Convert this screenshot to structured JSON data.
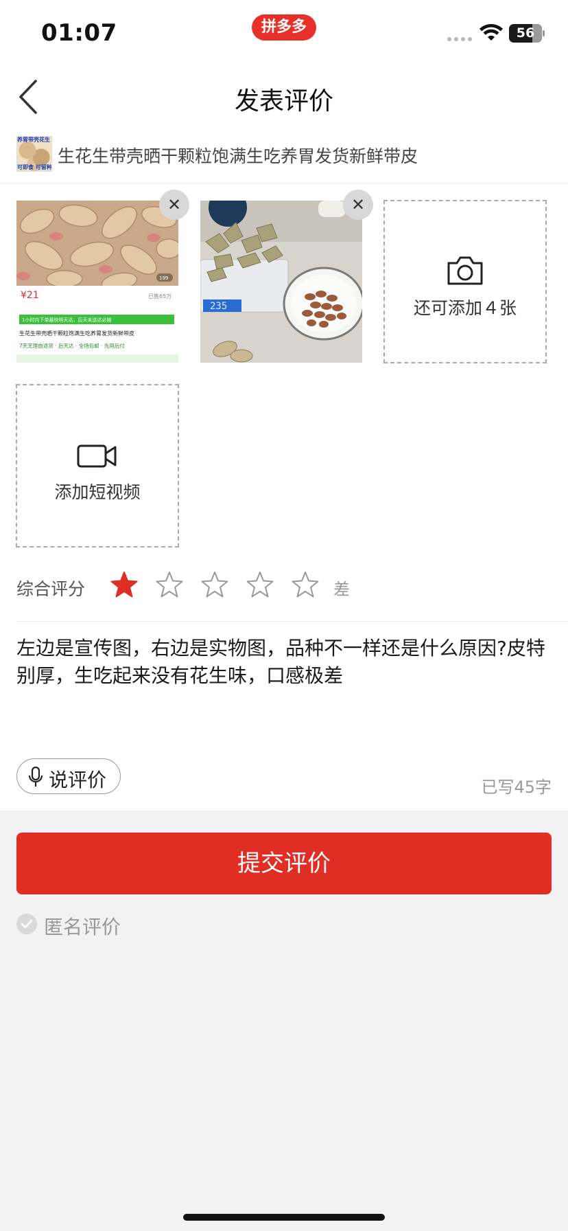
{
  "status_bar": {
    "time": "01:07",
    "app_badge": "拼多多",
    "battery": "56"
  },
  "nav": {
    "title": "发表评价",
    "back_icon": "chevron-left-icon"
  },
  "product": {
    "title": "生花生带壳晒干颗粒饱满生吃养胃发货新鲜带皮",
    "thumb_tag_top": "养胃带壳花生",
    "thumb_tag_bottom": "可即食 可留种"
  },
  "photos": {
    "add_photo_label": "还可添加４张",
    "add_video_label": "添加短视频",
    "remove_icon": "close-icon",
    "photo_1_labels": {
      "price": "¥21",
      "tag": "已售65万",
      "banner": "1小时内下单最快明天达，后天未送达必赔",
      "title": "生花生带壳晒干颗粒饱满生吃养胃发货新鲜带皮",
      "service": "7天无理由退货 · 后天达 · 全场包邮 · 先用后付",
      "badge": "199"
    },
    "photo_2_labels": {
      "scale_reading": "235"
    }
  },
  "rating": {
    "label": "综合评分",
    "value": 1,
    "max": 5,
    "text": "差",
    "filled_color": "#e02e24",
    "empty_color": "#999999"
  },
  "review": {
    "text": "左边是宣传图，右边是实物图，品种不一样还是什么原因?皮特别厚，生吃起来没有花生味，口感极差",
    "char_count": "已写45字"
  },
  "voice": {
    "label": "说评价",
    "icon": "microphone-icon"
  },
  "submit": {
    "label": "提交评价",
    "color": "#e02e24"
  },
  "anonymous": {
    "label": "匿名评价",
    "checked": false
  }
}
